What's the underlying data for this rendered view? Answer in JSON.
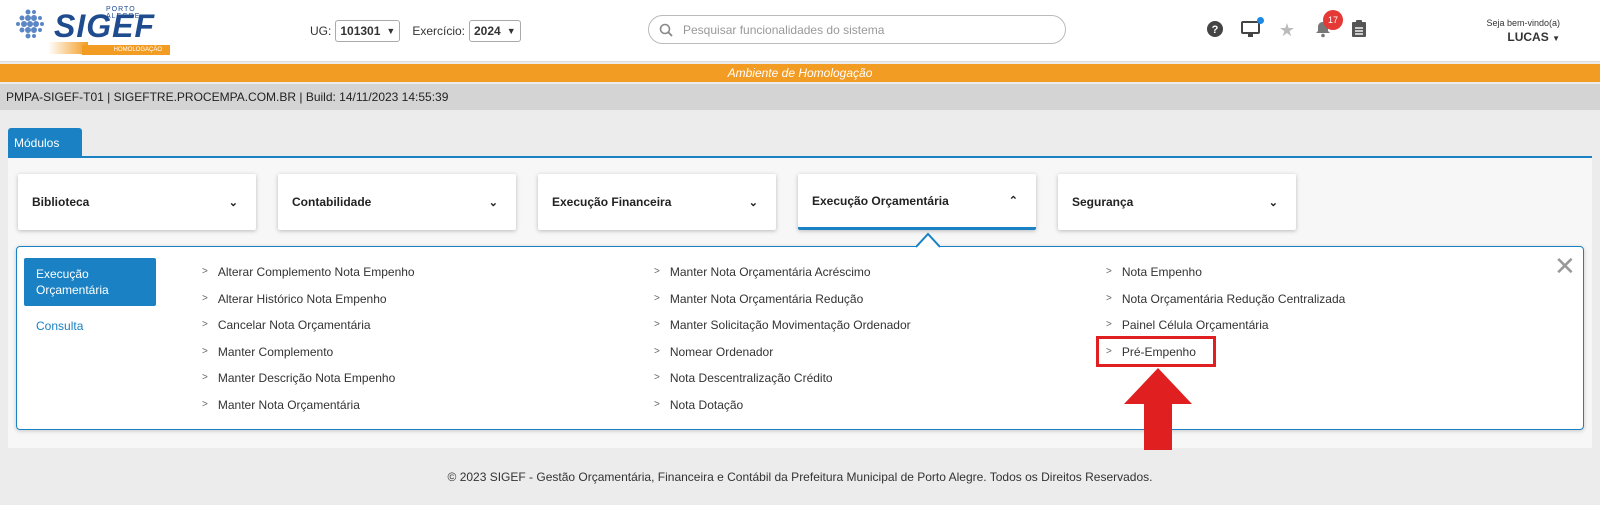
{
  "header": {
    "logo_city": "PORTO ALEGRE",
    "logo_brand": "SIGEF",
    "logo_env": "HOMOLOGAÇÃO",
    "ug_label": "UG:",
    "ug_value": "101301",
    "exercicio_label": "Exercício:",
    "exercicio_value": "2024",
    "search_placeholder": "Pesquisar funcionalidades do sistema",
    "notifications_count": "17",
    "welcome": "Seja bem-vindo(a)",
    "username": "LUCAS"
  },
  "environment_banner": "Ambiente de Homologação",
  "build_info": "PMPA-SIGEF-T01 | SIGEFTRE.PROCEMPA.COM.BR | Build: 14/11/2023 14:55:39",
  "tabs": [
    {
      "label": "Módulos"
    }
  ],
  "modules": [
    {
      "label": "Biblioteca"
    },
    {
      "label": "Contabilidade"
    },
    {
      "label": "Execução Financeira"
    },
    {
      "label": "Execução Orçamentária"
    },
    {
      "label": "Segurança"
    }
  ],
  "submenu": {
    "side": [
      {
        "label": "Execução Orçamentária"
      },
      {
        "label": "Consulta"
      }
    ],
    "col1": [
      "Alterar Complemento Nota Empenho",
      "Alterar Histórico Nota Empenho",
      "Cancelar Nota Orçamentária",
      "Manter Complemento",
      "Manter Descrição Nota Empenho",
      "Manter Nota Orçamentária"
    ],
    "col2": [
      "Manter Nota Orçamentária Acréscimo",
      "Manter Nota Orçamentária Redução",
      "Manter Solicitação Movimentação Ordenador",
      "Nomear Ordenador",
      "Nota Descentralização Crédito",
      "Nota Dotação"
    ],
    "col3": [
      "Nota Empenho",
      "Nota Orçamentária Redução Centralizada",
      "Painel Célula Orçamentária",
      "Pré-Empenho"
    ],
    "bullet": ">"
  },
  "footer": "© 2023 SIGEF - Gestão Orçamentária, Financeira e Contábil da Prefeitura Municipal de Porto Alegre. Todos os Direitos Reservados.",
  "colors": {
    "accent": "#1a82c4",
    "homologation": "#f39c24",
    "highlight": "#e02020"
  }
}
